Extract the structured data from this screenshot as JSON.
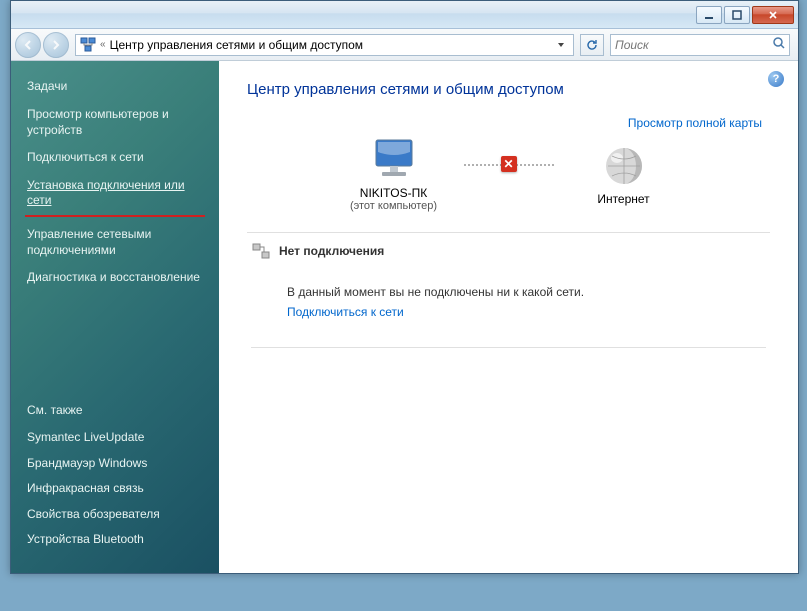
{
  "toolbar": {
    "breadcrumb_prefix": "«",
    "breadcrumb": "Центр управления сетями и общим доступом",
    "search_placeholder": "Поиск"
  },
  "sidebar": {
    "header": "Задачи",
    "items": [
      "Просмотр компьютеров и устройств",
      "Подключиться к сети",
      "Установка подключения или сети",
      "Управление сетевыми подключениями",
      "Диагностика и восстановление"
    ],
    "footer_header": "См. также",
    "footer_items": [
      "Symantec LiveUpdate",
      "Брандмауэр Windows",
      "Инфракрасная связь",
      "Свойства обозревателя",
      "Устройства Bluetooth"
    ]
  },
  "main": {
    "title": "Центр управления сетями и общим доступом",
    "map_link": "Просмотр полной карты",
    "node_pc_name": "NIKITOS-ПК",
    "node_pc_sub": "(этот компьютер)",
    "node_internet": "Интернет",
    "section_noconn": "Нет подключения",
    "noconn_msg": "В данный момент вы не подключены ни к какой сети.",
    "connect_link": "Подключиться к сети"
  },
  "icons": {
    "help": "?",
    "x": "✕"
  }
}
